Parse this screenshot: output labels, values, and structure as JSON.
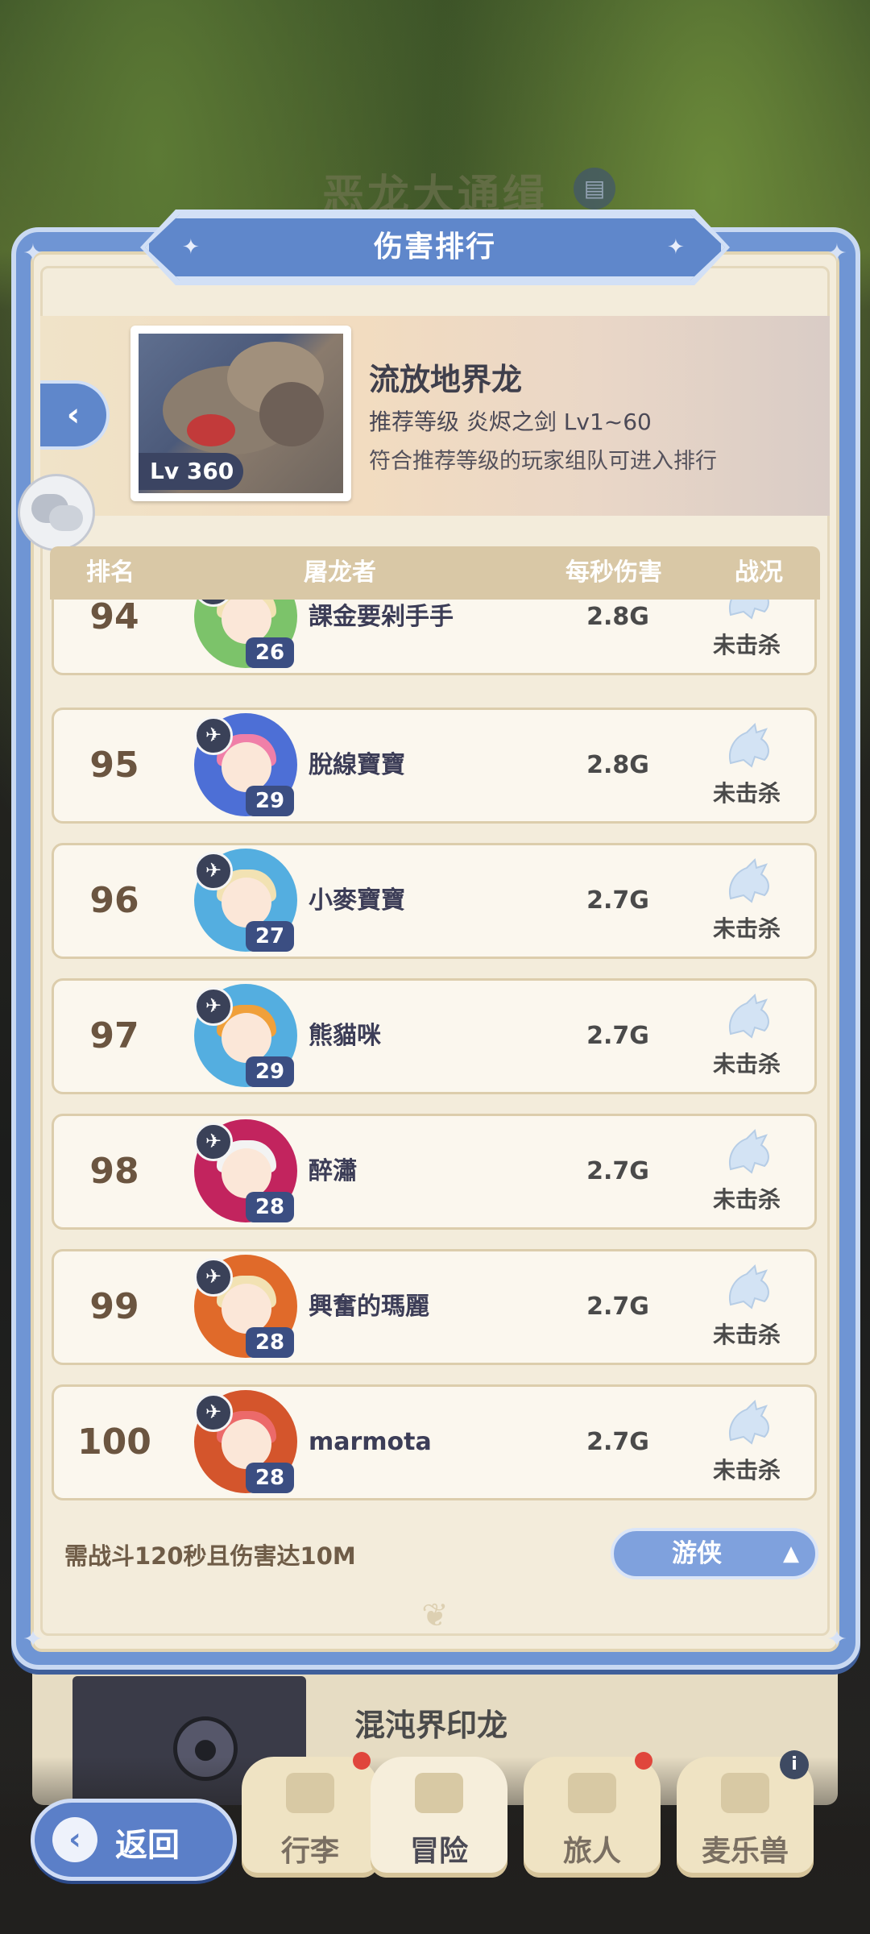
{
  "background": {
    "title": "恶龙大通缉",
    "card_title": "混沌界印龙"
  },
  "modal": {
    "title": "伤害排行",
    "boss": {
      "name": "流放地界龙",
      "level": "Lv 360",
      "recommend": "推荐等级 炎烬之剑 Lv1~60",
      "note": "符合推荐等级的玩家组队可进入排行"
    },
    "table_headers": {
      "rank": "排名",
      "slayer": "屠龙者",
      "dps": "每秒伤害",
      "status": "战况"
    },
    "rows": [
      {
        "rank": "94",
        "name": "課金要剁手手",
        "level": "26",
        "dps": "2.8G",
        "status": "未击杀",
        "frame": "#7cc36a",
        "hair": "#f2e2b3"
      },
      {
        "rank": "95",
        "name": "脫線寶寶",
        "level": "29",
        "dps": "2.8G",
        "status": "未击杀",
        "frame": "#4d6fd6",
        "hair": "#f07fa8"
      },
      {
        "rank": "96",
        "name": "小麥寶寶",
        "level": "27",
        "dps": "2.7G",
        "status": "未击杀",
        "frame": "#54aee0",
        "hair": "#f2e2b3"
      },
      {
        "rank": "97",
        "name": "熊貓咪",
        "level": "29",
        "dps": "2.7G",
        "status": "未击杀",
        "frame": "#54aee0",
        "hair": "#f0a03a"
      },
      {
        "rank": "98",
        "name": "醉瀟",
        "level": "28",
        "dps": "2.7G",
        "status": "未击杀",
        "frame": "#c2245e",
        "hair": "#f3f3f3"
      },
      {
        "rank": "99",
        "name": "興奮的瑪麗",
        "level": "28",
        "dps": "2.7G",
        "status": "未击杀",
        "frame": "#e06a2a",
        "hair": "#f2e2b3"
      },
      {
        "rank": "100",
        "name": "marmota",
        "level": "28",
        "dps": "2.7G",
        "status": "未击杀",
        "frame": "#d4552c",
        "hair": "#ec6a6a"
      }
    ],
    "requirement": "需战斗120秒且伤害达10M",
    "class_filter": "游侠"
  },
  "bottom_nav": {
    "back_label": "返回",
    "tabs": [
      {
        "label": "行李"
      },
      {
        "label": "冒险"
      },
      {
        "label": "旅人"
      },
      {
        "label": "麦乐兽"
      }
    ]
  },
  "colors": {
    "modal_blue": "#6f95d4",
    "parchment": "#f3ecdb",
    "rank_text": "#6b5540"
  }
}
